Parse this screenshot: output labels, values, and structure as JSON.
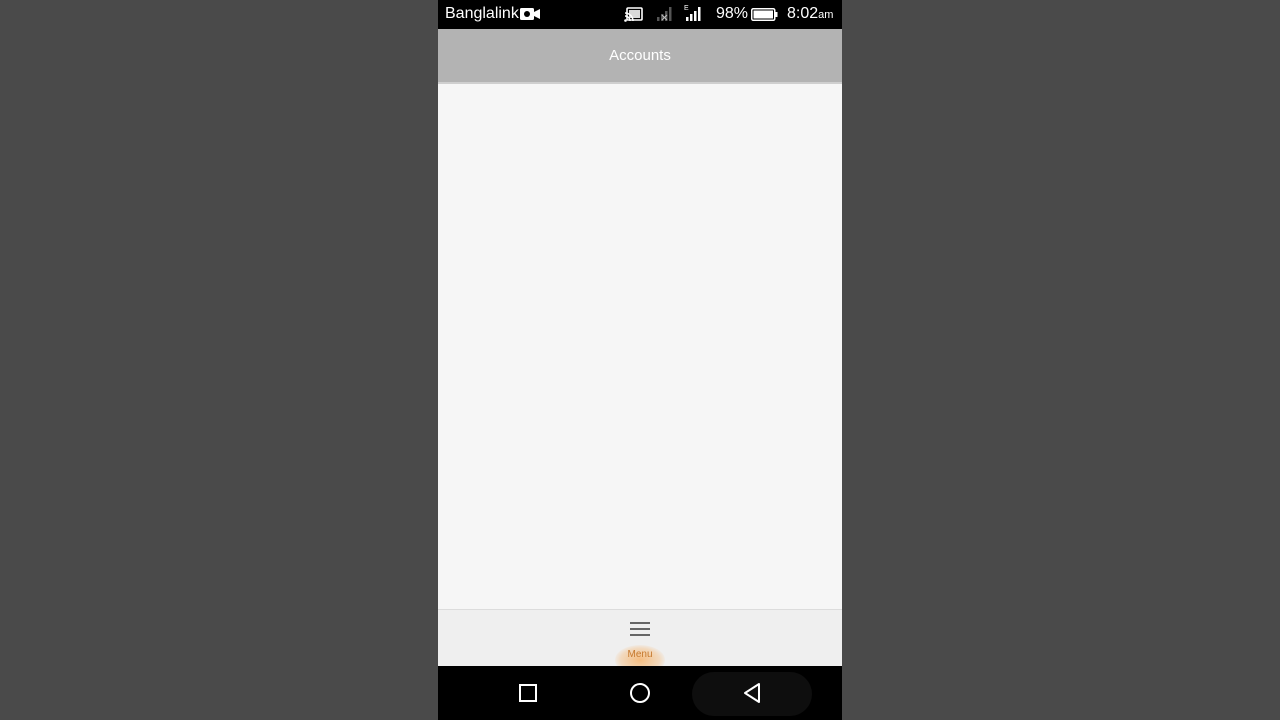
{
  "status_bar": {
    "carrier": "Banglalink",
    "network_type": "E",
    "battery_percent": "98%",
    "time": "8:02",
    "time_suffix": "am",
    "icons": [
      "video-record-icon",
      "cast-icon",
      "signal-no-service-icon",
      "signal-bars-icon",
      "battery-icon"
    ]
  },
  "app_bar": {
    "title": "Accounts"
  },
  "bottom_bar": {
    "menu_label": "Menu",
    "menu_icon": "hamburger-menu-icon",
    "accent_color": "#c77a2e"
  },
  "nav_bar": {
    "buttons": [
      "recents-square-icon",
      "home-circle-icon",
      "back-triangle-icon"
    ]
  },
  "colors": {
    "app_bar_bg": "#b3b3b3",
    "content_bg": "#f6f6f6",
    "outer_bg": "#4a4a4a"
  }
}
